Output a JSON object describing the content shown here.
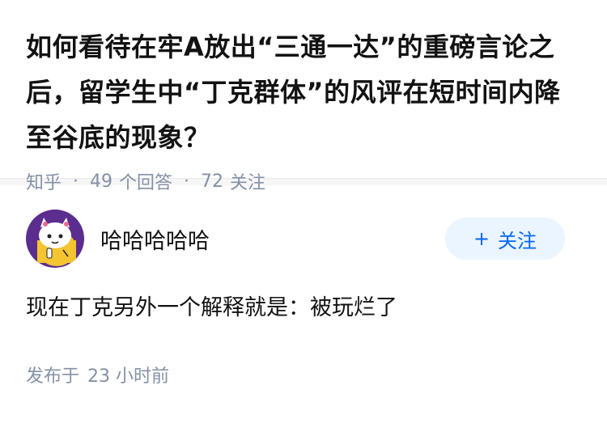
{
  "question": {
    "title": "如何看待在牢A放出“三通一达”的重磅言论之后，留学生中“丁克群体”的风评在短时间内降至谷底的现象？",
    "source": "知乎",
    "answers_count": "49",
    "answers_label": "个回答",
    "followers_count": "72",
    "followers_label": "关注",
    "separator": "·"
  },
  "answer": {
    "author_name": "哈哈哈哈哈",
    "avatar_icon": "cartoon-cat-avatar",
    "follow_label": "关注",
    "follow_plus": "+",
    "content": "现在丁克另外一个解释就是：被玩烂了",
    "published_label": "发布于",
    "published_value": "23 小时前"
  },
  "colors": {
    "accent": "#0066ff",
    "button_bg": "#ebf5ff",
    "meta_text": "#8590a6",
    "avatar_bg": "#5b2d8e"
  }
}
